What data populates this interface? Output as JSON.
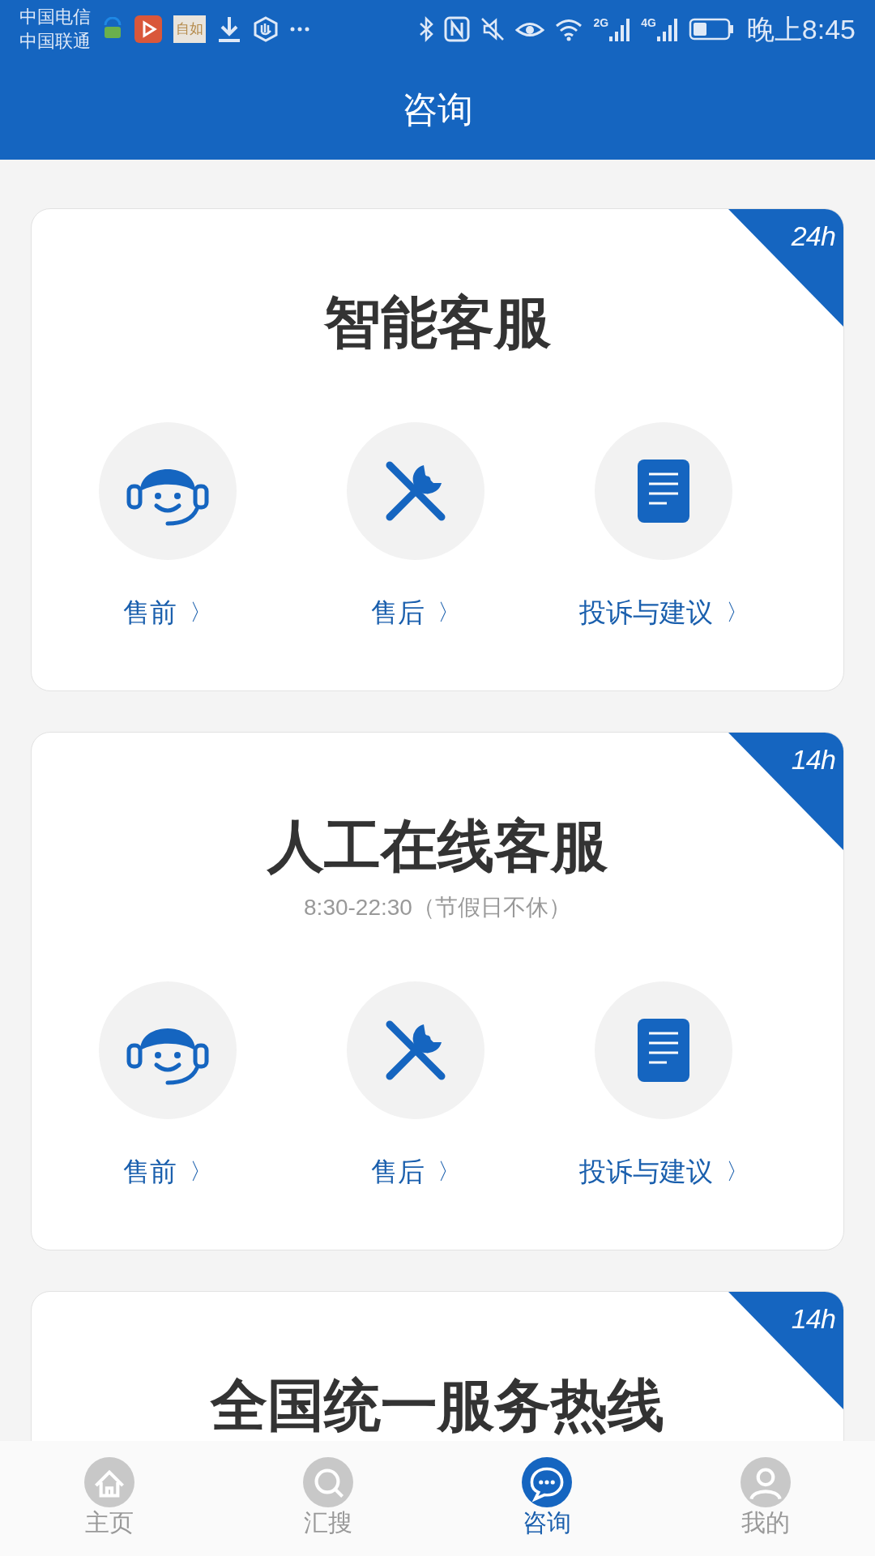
{
  "status_bar": {
    "carriers": [
      "中国电信",
      "中国联通"
    ],
    "app_badge": "自如",
    "networks": [
      "2G",
      "4G"
    ],
    "time": "晚上8:45"
  },
  "header": {
    "title": "咨询"
  },
  "cards": [
    {
      "title": "智能客服",
      "badge": "24h",
      "actions": [
        {
          "kind": "headset",
          "label": "售前",
          "arrow": "〉"
        },
        {
          "kind": "tools",
          "label": "售后",
          "arrow": "〉"
        },
        {
          "kind": "document",
          "label": "投诉与建议",
          "arrow": "〉"
        }
      ]
    },
    {
      "title": "人工在线客服",
      "badge": "14h",
      "subtitle": "8:30-22:30（节假日不休）",
      "actions": [
        {
          "kind": "headset",
          "label": "售前",
          "arrow": "〉"
        },
        {
          "kind": "tools",
          "label": "售后",
          "arrow": "〉"
        },
        {
          "kind": "document",
          "label": "投诉与建议",
          "arrow": "〉"
        }
      ]
    },
    {
      "title": "全国统一服务热线",
      "badge": "14h"
    }
  ],
  "bottom_nav": [
    {
      "kind": "home",
      "label": "主页",
      "selected": false
    },
    {
      "kind": "search",
      "label": "汇搜",
      "selected": false
    },
    {
      "kind": "chat",
      "label": "咨询",
      "selected": true
    },
    {
      "kind": "profile",
      "label": "我的",
      "selected": false
    }
  ]
}
